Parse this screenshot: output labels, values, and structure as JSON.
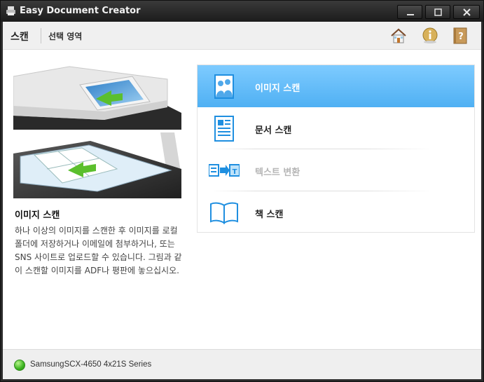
{
  "window": {
    "title": "Easy Document Creator"
  },
  "toolbar": {
    "scan_label": "스캔",
    "area_label": "선택 영역"
  },
  "description": {
    "title": "이미지 스캔",
    "body": "하나 이상의 이미지를 스캔한 후 이미지를 로컬 폴더에 저장하거나 이메일에 첨부하거나, 또는 SNS 사이트로 업로드할 수 있습니다. 그림과 같이 스캔할 이미지를 ADF나 평판에 놓으십시오."
  },
  "menu": {
    "items": [
      {
        "label": "이미지 스캔",
        "icon": "image-scan-icon",
        "selected": true,
        "enabled": true
      },
      {
        "label": "문서 스캔",
        "icon": "document-scan-icon",
        "selected": false,
        "enabled": true
      },
      {
        "label": "텍스트 변환",
        "icon": "text-convert-icon",
        "selected": false,
        "enabled": false
      },
      {
        "label": "책 스캔",
        "icon": "book-scan-icon",
        "selected": false,
        "enabled": true
      }
    ]
  },
  "status": {
    "device": "SamsungSCX-4650 4x21S Series",
    "state_color": "#3cb320"
  },
  "colors": {
    "accent": "#4fb0f3",
    "icon_blue": "#1f8fe0"
  }
}
